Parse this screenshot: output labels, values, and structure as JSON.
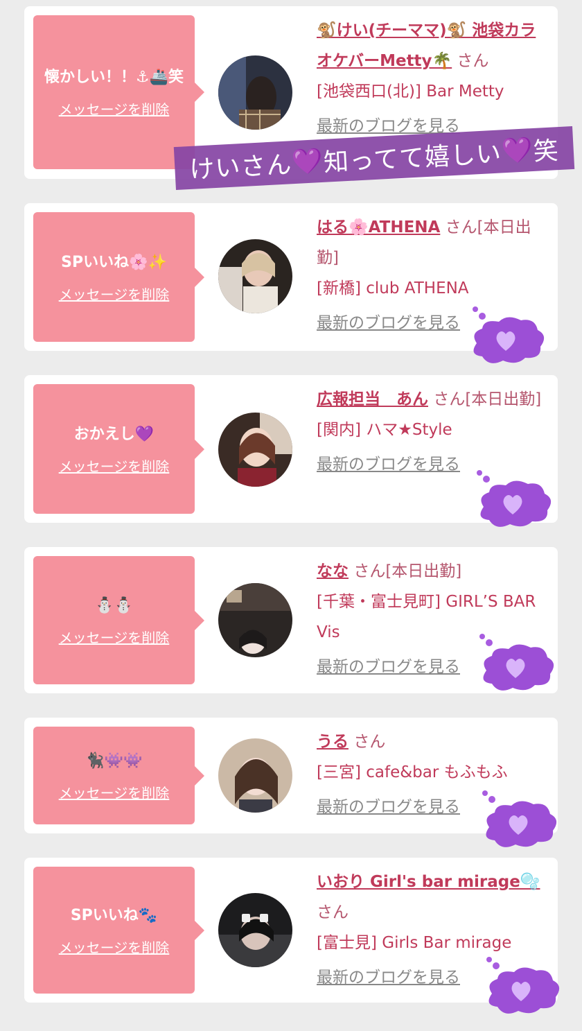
{
  "colors": {
    "bubble": "#f5929d",
    "name_link": "#c03a5a",
    "blog_link": "#888888",
    "banner_bg": "#8746a5",
    "thought_heart": "#b873ef"
  },
  "cards": [
    {
      "message": "懐かしい！！⚓🚢笑",
      "delete_label": "メッセージを削除",
      "name": "🐒けい(チーママ)🐒 池袋カラオケバーMetty🌴",
      "honorific": "さん",
      "shop": "[池袋西口(北)] Bar Metty",
      "blog_label": "最新のブログを見る"
    },
    {
      "message": "SPいいね🌸✨",
      "delete_label": "メッセージを削除",
      "name": "はる🌸ATHENA",
      "honorific": "さん[本日出勤]",
      "shop": "[新橋] club ATHENA",
      "blog_label": "最新のブログを見る"
    },
    {
      "message": "おかえし💜",
      "delete_label": "メッセージを削除",
      "name": "広報担当　あん",
      "honorific": "さん[本日出勤]",
      "shop": "[関内] ハマ★Style",
      "blog_label": "最新のブログを見る"
    },
    {
      "message": "⛄⛄",
      "delete_label": "メッセージを削除",
      "name": "なな",
      "honorific": "さん[本日出勤]",
      "shop": "[千葉・富士見町] GIRL’S BAR Vis",
      "blog_label": "最新のブログを見る"
    },
    {
      "message": "🐈‍⬛👾👾",
      "delete_label": "メッセージを削除",
      "name": "うる",
      "honorific": "さん",
      "shop": "[三宮] cafe&bar もふもふ",
      "blog_label": "最新のブログを見る"
    },
    {
      "message": "SPいいね🐾",
      "delete_label": "メッセージを削除",
      "name": "いおり Girl's bar mirage🫧",
      "honorific": "さん",
      "shop": "[富士見] Girls Bar mirage",
      "blog_label": "最新のブログを見る"
    }
  ],
  "banner": {
    "part1": "けいさん",
    "heart": "💜",
    "part2": "知ってて嬉しい",
    "part3": "笑"
  }
}
